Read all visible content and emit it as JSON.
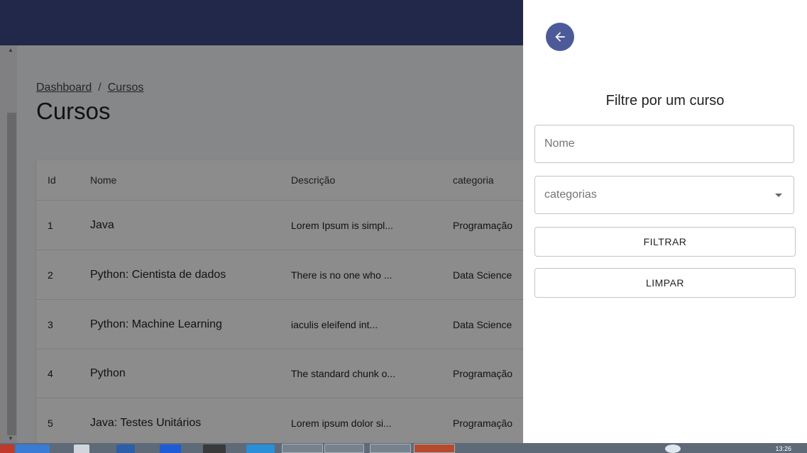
{
  "breadcrumb": {
    "home": "Dashboard",
    "separator": "/",
    "current": "Cursos"
  },
  "page": {
    "title": "Cursos"
  },
  "table": {
    "headers": {
      "id": "Id",
      "nome": "Nome",
      "descricao": "Descrição",
      "categoria": "categoria"
    },
    "rows": [
      {
        "id": "1",
        "nome": "Java",
        "descricao": "Lorem Ipsum is simpl...",
        "categoria": "Programação"
      },
      {
        "id": "2",
        "nome": "Python: Cientista de dados",
        "descricao": "There is no one who ...",
        "categoria": "Data Science"
      },
      {
        "id": "3",
        "nome": "Python: Machine Learning",
        "descricao": "iaculis eleifend int...",
        "categoria": "Data Science"
      },
      {
        "id": "4",
        "nome": "Python",
        "descricao": "The standard chunk o...",
        "categoria": "Programação"
      },
      {
        "id": "5",
        "nome": "Java: Testes Unitários",
        "descricao": "Lorem ipsum dolor si...",
        "categoria": "Programação"
      }
    ]
  },
  "drawer": {
    "back_icon": "arrow-left-icon",
    "title": "Filtre por um curso",
    "name_placeholder": "Nome",
    "category_placeholder": "categorias",
    "filter_label": "FILTRAR",
    "clear_label": "LIMPAR"
  },
  "taskbar": {
    "clock": "13:26"
  },
  "colors": {
    "topbar": "#3f4a86",
    "back_button": "#4d5a99",
    "overlay": "rgba(0,0,0,0.45)"
  }
}
